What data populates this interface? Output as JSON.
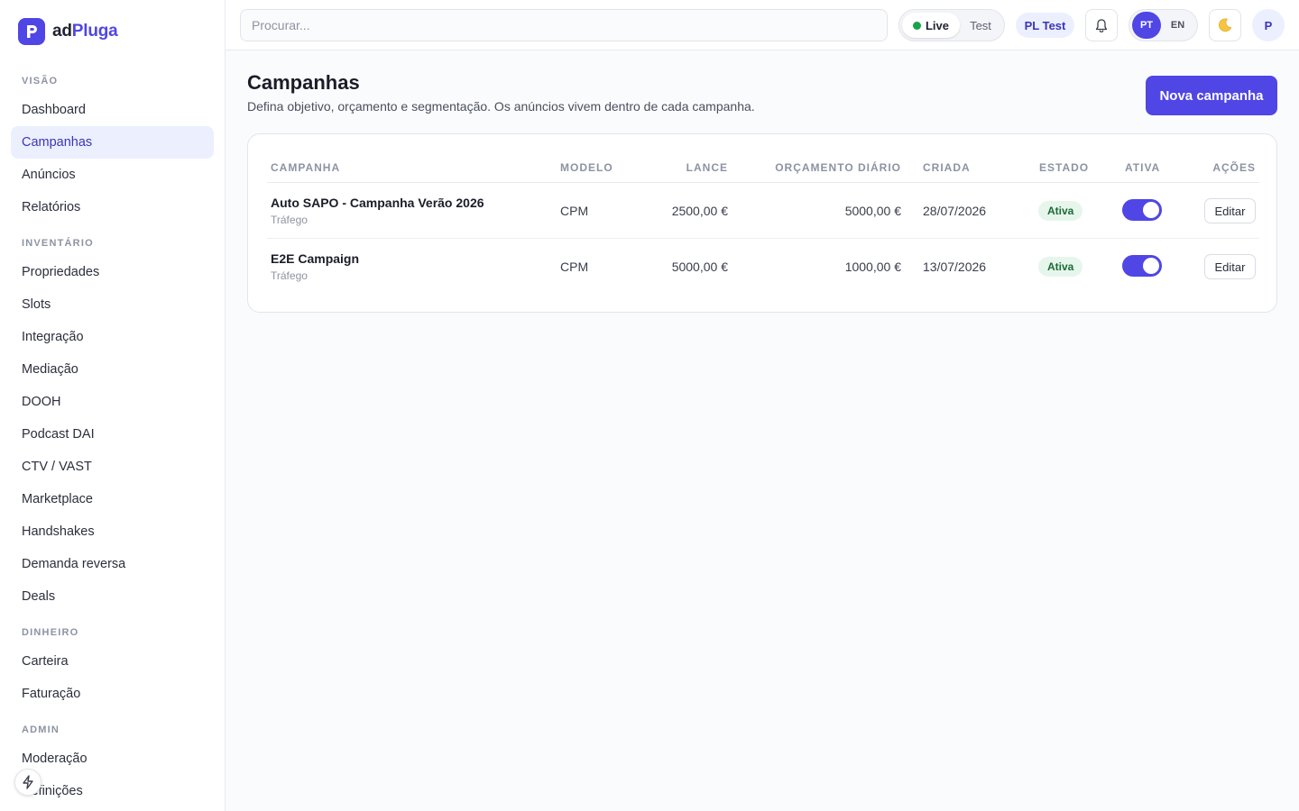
{
  "app": {
    "logo_mark": "P",
    "logo_text_a": "ad",
    "logo_text_b": "Pluga",
    "brand_color": "#4f46e5"
  },
  "sidebar": {
    "sections": [
      {
        "title": "VISÃO",
        "items": [
          "Dashboard",
          "Campanhas",
          "Anúncios",
          "Relatórios"
        ]
      },
      {
        "title": "INVENTÁRIO",
        "items": [
          "Propriedades",
          "Slots",
          "Integração",
          "Mediação",
          "DOOH",
          "Podcast DAI",
          "CTV / VAST",
          "Marketplace",
          "Handshakes",
          "Demanda reversa",
          "Deals"
        ]
      },
      {
        "title": "DINHEIRO",
        "items": [
          "Carteira",
          "Faturação"
        ]
      },
      {
        "title": "ADMIN",
        "items": [
          "Moderação",
          "Definições"
        ]
      }
    ],
    "active_item": "Campanhas",
    "bolt_icon": "bolt-icon"
  },
  "topbar": {
    "search_placeholder": "Procurar...",
    "env_live": "Live",
    "env_test": "Test",
    "org": "PL Test",
    "bell_icon": "bell-icon",
    "lang_pt": "PT",
    "lang_en": "EN",
    "theme_icon": "moon-icon",
    "avatar": "P"
  },
  "main": {
    "title": "Campanhas",
    "subtitle": "Defina objetivo, orçamento e segmentação. Os anúncios vivem dentro de cada campanha.",
    "new_button": "Nova campanha",
    "table": {
      "headers": {
        "campanha": "CAMPANHA",
        "modelo": "MODELO",
        "lance": "LANCE",
        "orcamento": "ORÇAMENTO DIÁRIO",
        "criada": "CRIADA",
        "estado": "ESTADO",
        "ativa": "ATIVA",
        "acoes": "AÇÕES"
      },
      "rows": [
        {
          "name": "Auto SAPO - Campanha Verão 2026",
          "goal": "Tráfego",
          "model": "CPM",
          "bid": "2500,00 €",
          "budget": "5000,00 €",
          "created": "28/07/2026",
          "status": "Ativa",
          "active": true,
          "action": "Editar"
        },
        {
          "name": "E2E Campaign",
          "goal": "Tráfego",
          "model": "CPM",
          "bid": "5000,00 €",
          "budget": "1000,00 €",
          "created": "13/07/2026",
          "status": "Ativa",
          "active": true,
          "action": "Editar"
        }
      ]
    }
  }
}
